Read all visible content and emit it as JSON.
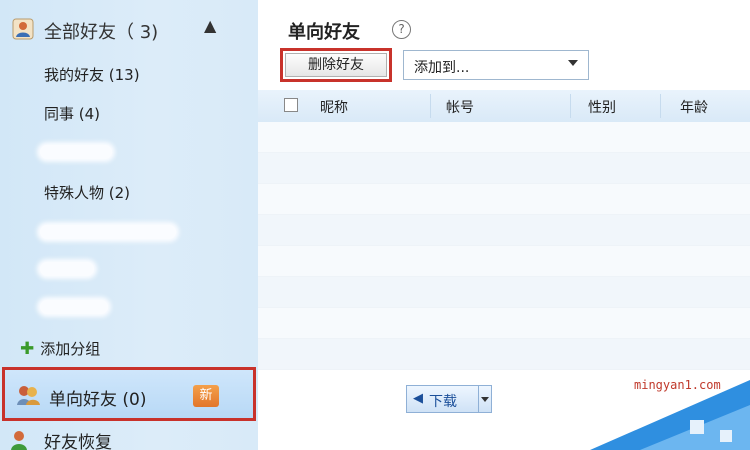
{
  "sidebar": {
    "header_title": "全部好友（ 3)",
    "groups": [
      {
        "label": "我的好友 (13)"
      },
      {
        "label": "同事 (4)"
      },
      {
        "label": "特殊人物 (2)"
      }
    ],
    "add_group_label": "添加分组",
    "oneway": {
      "label": "单向好友 (0)",
      "badge": "新"
    },
    "recover_label": "好友恢复"
  },
  "main": {
    "title": "单向好友",
    "help_symbol": "?",
    "delete_label": "删除好友",
    "add_to_value": "添加到...",
    "columns": [
      "昵称",
      "帐号",
      "性别",
      "年龄"
    ],
    "pager_label": "下载"
  },
  "watermark": "mingyan1.com",
  "colors": {
    "highlight_border": "#c8322b",
    "sidebar_bg": "#d6e9f8",
    "badge": "#e9852f"
  }
}
